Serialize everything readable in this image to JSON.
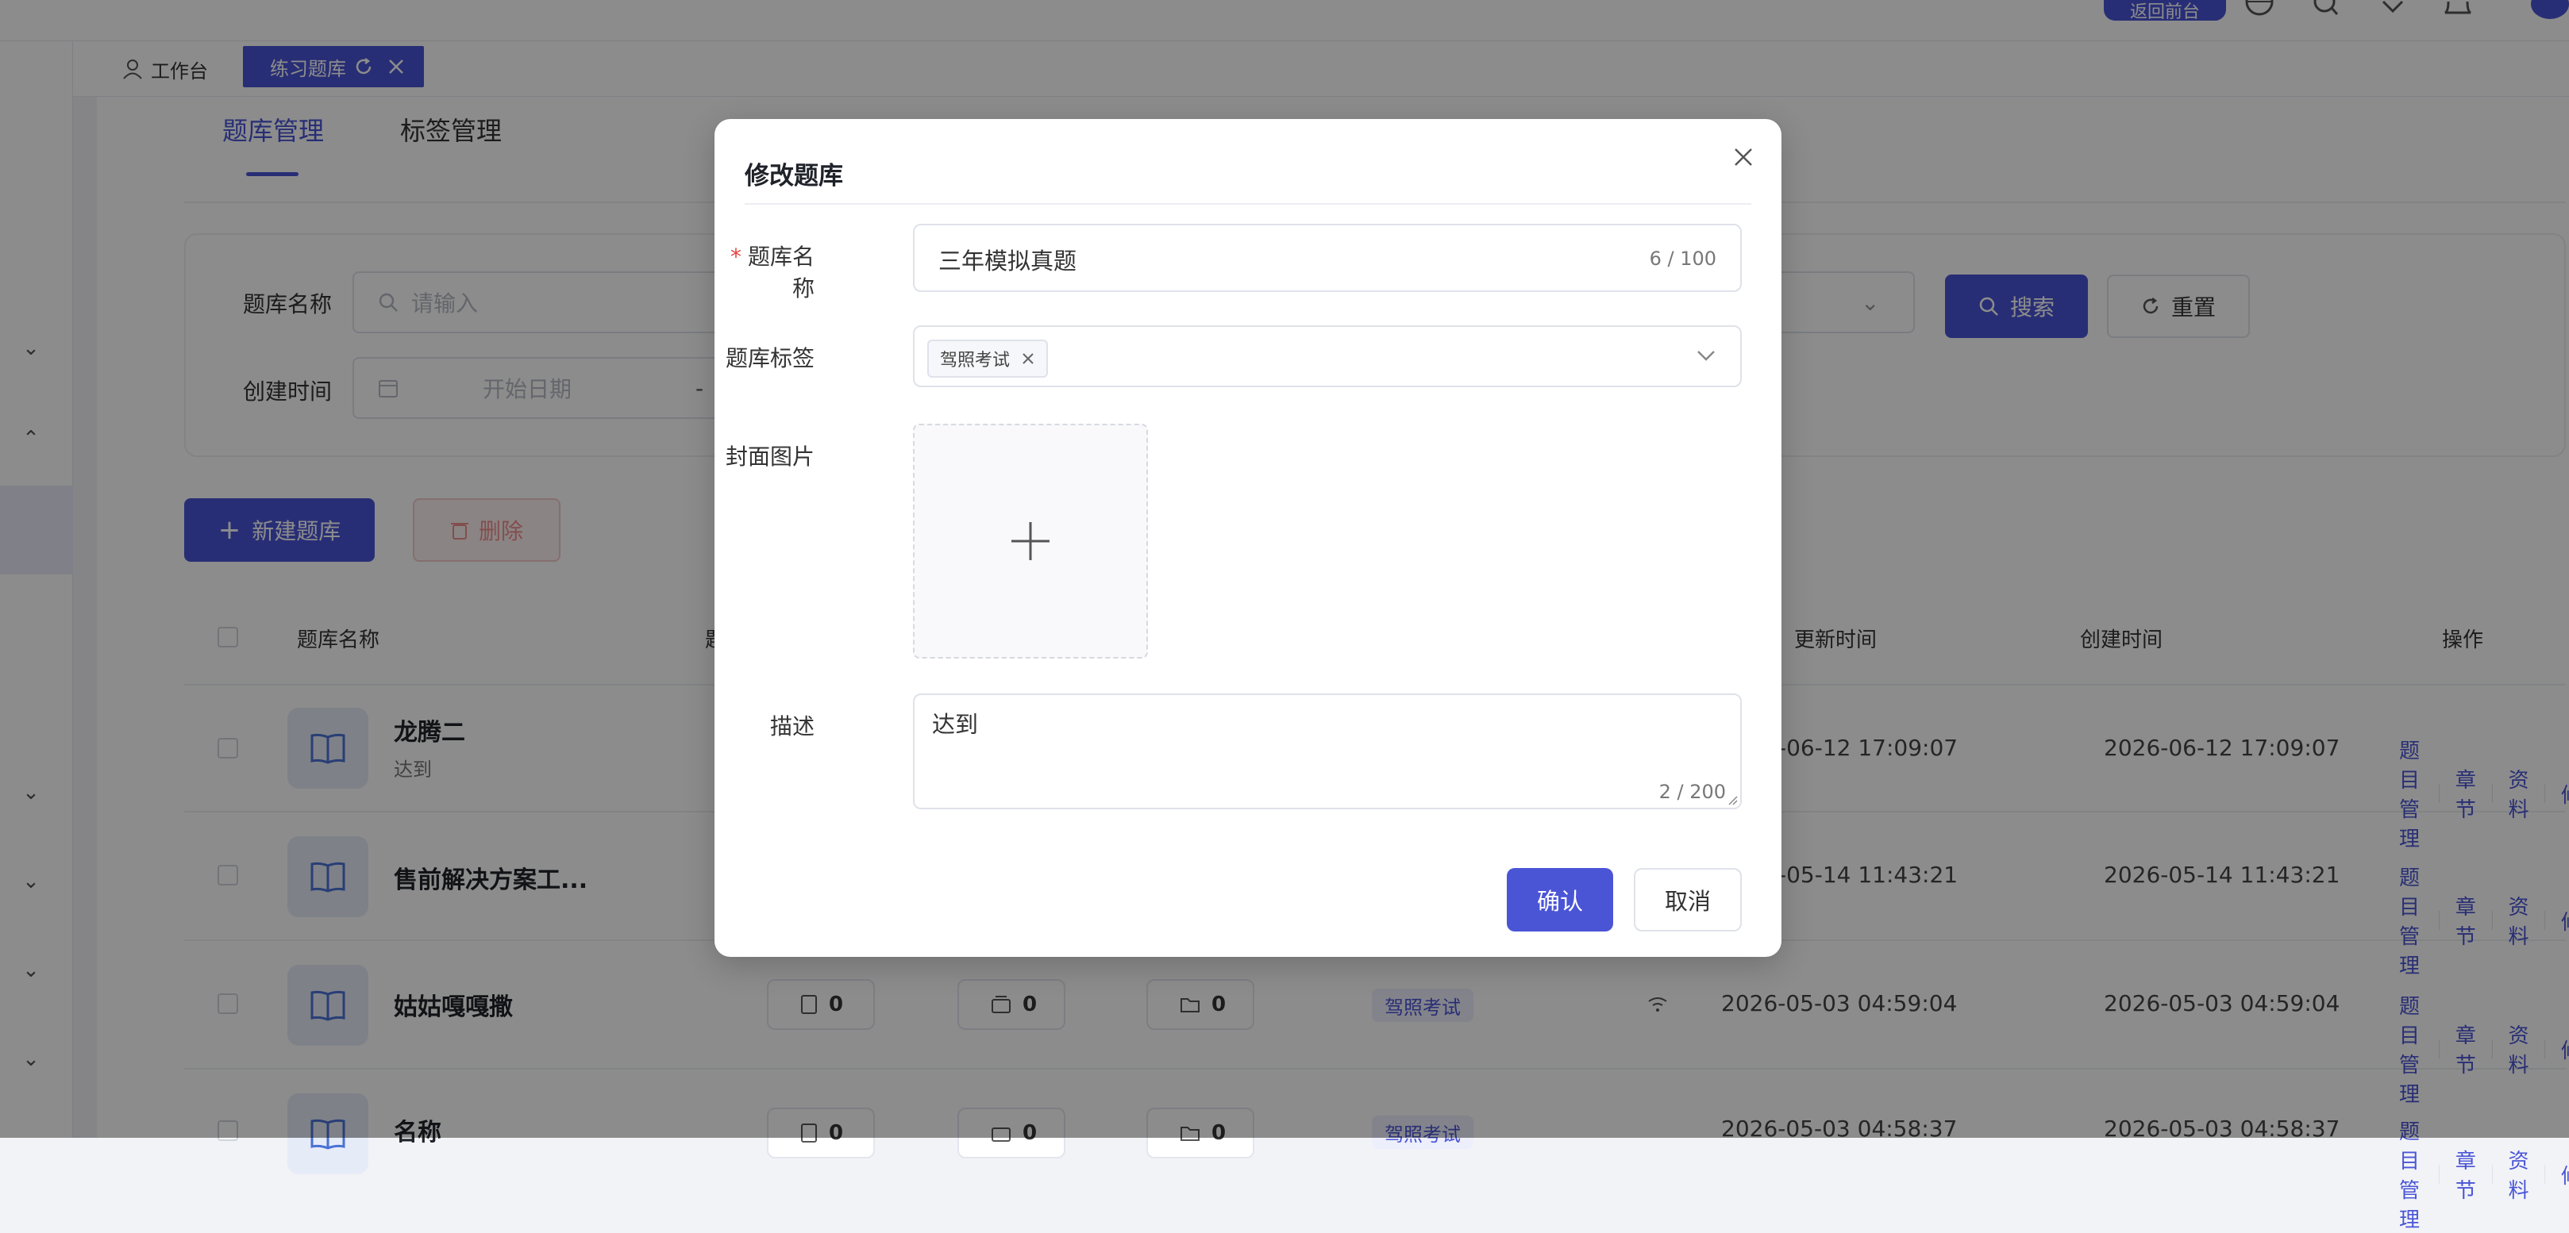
{
  "topbar": {
    "return_label": "返回前台"
  },
  "tabs": {
    "workspace": "工作台",
    "active": "练习题库"
  },
  "subtabs": {
    "bank_manage": "题库管理",
    "tag_manage": "标签管理"
  },
  "filter": {
    "name_label": "题库名称",
    "name_placeholder": "请输入",
    "created_label": "创建时间",
    "start_placeholder": "开始日期",
    "range_sep": "-",
    "search_button": "搜索",
    "reset_button": "重置"
  },
  "actions": {
    "new_button": "新建题库",
    "delete_button": "删除"
  },
  "table": {
    "headers": {
      "name": "题库名称",
      "partial": "题",
      "updated": "更新时间",
      "created": "创建时间",
      "ops": "操作"
    },
    "rows": [
      {
        "name": "龙腾二",
        "sub": "达到",
        "updated": "-06-12 17:09:07",
        "created": "2026-06-12 17:09:07"
      },
      {
        "name": "售前解决方案工...",
        "updated": "-05-14 11:43:21",
        "created": "2026-05-14 11:43:21"
      },
      {
        "name": "姑姑嘎嘎撒",
        "q": "0",
        "p": "0",
        "f": "0",
        "tag": "驾照考试",
        "updated": "2026-05-03 04:59:04",
        "created": "2026-05-03 04:59:04"
      },
      {
        "name": "名称",
        "q": "0",
        "p": "0",
        "f": "0",
        "tag": "驾照考试",
        "updated": "2026-05-03 04:58:37",
        "created": "2026-05-03 04:58:37"
      }
    ],
    "ops": {
      "questions": "题目管理",
      "chapters": "章节",
      "materials": "资料",
      "edit": "修"
    }
  },
  "modal": {
    "title": "修改题库",
    "name_label": "题库名称",
    "name_value": "三年模拟真题",
    "name_count": "6 / 100",
    "tag_label": "题库标签",
    "tag_chip": "驾照考试",
    "cover_label": "封面图片",
    "desc_label": "描述",
    "desc_value": "达到",
    "desc_count": "2 / 200",
    "confirm_button": "确认",
    "cancel_button": "取消"
  },
  "colors": {
    "primary": "#4a55d6",
    "danger": "#e54545"
  }
}
